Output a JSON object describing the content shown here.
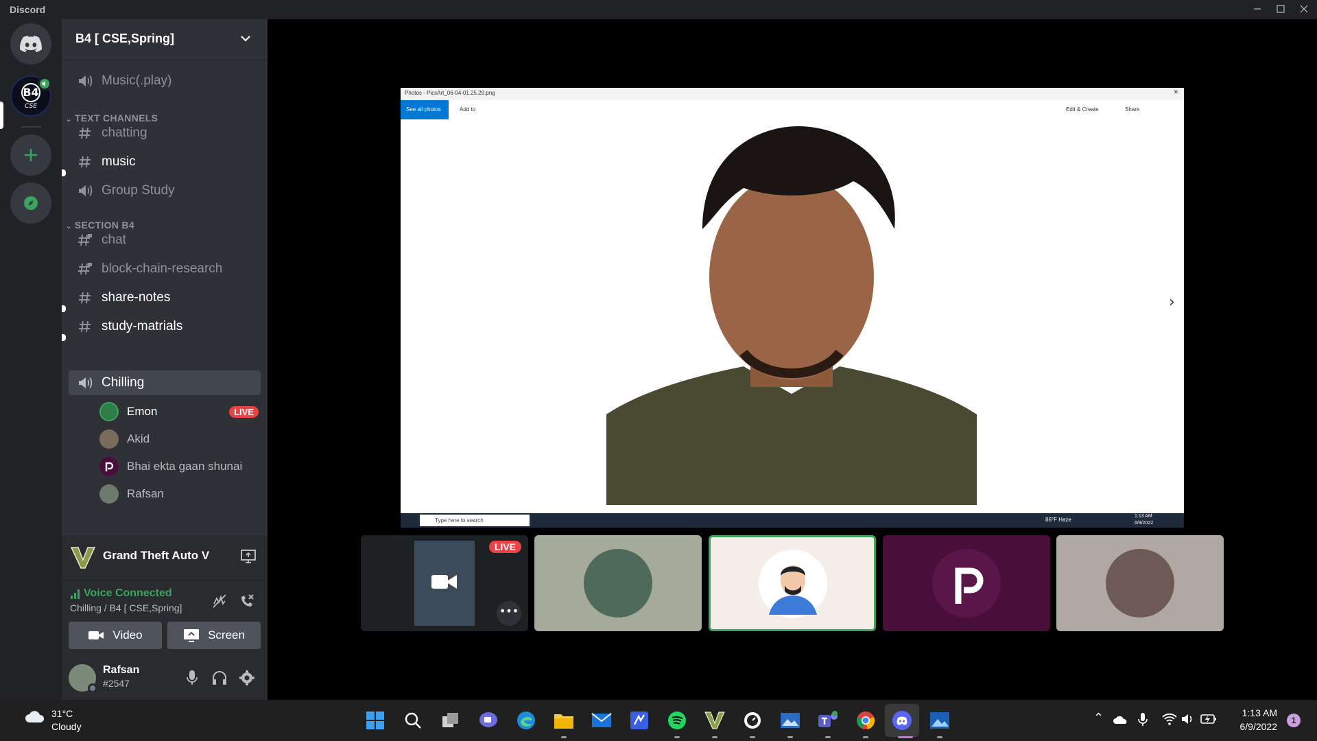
{
  "window": {
    "title": "Discord",
    "minimize_icon": "minimize-icon",
    "maximize_icon": "maximize-icon",
    "close_icon": "close-icon"
  },
  "guilds": [
    {
      "name": "Home",
      "icon": "discord-logo-icon"
    },
    {
      "name": "B4 CSE",
      "icon": "server-b4-icon",
      "avatar_text": "B4",
      "avatar_sub": "CSE"
    },
    {
      "name": "Add a Server",
      "icon": "plus-icon"
    },
    {
      "name": "Explore Public Servers",
      "icon": "compass-icon"
    }
  ],
  "server": {
    "name": "B4 [ CSE,Spring]"
  },
  "channels_top": [
    {
      "name": "Music(.play)",
      "type": "voice"
    }
  ],
  "categories": [
    {
      "name": "TEXT CHANNELS",
      "channels": [
        {
          "name": "chatting",
          "type": "text",
          "unread": false
        },
        {
          "name": "music",
          "type": "text",
          "unread": true
        },
        {
          "name": "Group Study",
          "type": "voice",
          "unread": false
        }
      ]
    },
    {
      "name": "SECTION B4",
      "channels": [
        {
          "name": "chat",
          "type": "text-locked",
          "unread": false
        },
        {
          "name": "block-chain-research",
          "type": "text-locked",
          "unread": false
        },
        {
          "name": "share-notes",
          "type": "text",
          "unread": true
        },
        {
          "name": "study-matrials",
          "type": "text",
          "unread": true
        },
        {
          "name": "Chilling",
          "type": "voice",
          "unread": false,
          "active": true
        }
      ]
    }
  ],
  "voice_users": [
    {
      "name": "Emon",
      "badge": "LIVE"
    },
    {
      "name": "Akid"
    },
    {
      "name": "Bhai ekta gaan shunai"
    },
    {
      "name": "Rafsan"
    }
  ],
  "activity": {
    "game": "Grand Theft Auto V",
    "stream_icon": "screen-share-icon"
  },
  "voice_status": {
    "state": "Voice Connected",
    "location": "Chilling / B4 [ CSE,Spring]"
  },
  "voice_buttons": {
    "video": "Video",
    "screen": "Screen"
  },
  "user": {
    "name": "Rafsan",
    "tag": "#2547"
  },
  "stream": {
    "photos_title": "Photos - PicsArt_06-04-01.25.29.png",
    "see_all": "See all photos",
    "add_to": "Add to",
    "edit_create": "Edit & Create",
    "share": "Share",
    "search_placeholder": "Type here to search",
    "weather": "86°F Haze",
    "time": "1:13 AM",
    "date": "6/9/2022"
  },
  "tiles": [
    {
      "label": "LIVE",
      "type": "stream"
    },
    {
      "type": "avatar"
    },
    {
      "type": "avatar",
      "speaking": true
    },
    {
      "type": "avatar"
    },
    {
      "type": "avatar"
    }
  ],
  "taskbar": {
    "weather_temp": "31°C",
    "weather_desc": "Cloudy",
    "time": "1:13 AM",
    "date": "6/9/2022",
    "notifications": "1",
    "apps": [
      "start-icon",
      "search-icon",
      "task-view-icon",
      "chat-icon",
      "edge-icon",
      "file-explorer-icon",
      "mail-icon",
      "visual-studio-icon",
      "spotify-icon",
      "gta-icon",
      "clock-app-icon",
      "photos-app-icon",
      "teams-icon",
      "chrome-icon",
      "discord-icon",
      "photos-icon"
    ]
  },
  "colors": {
    "accent": "#5865f2",
    "green": "#3ba55d",
    "live": "#ed4245",
    "sidebar": "#2f3136",
    "guilds": "#202225"
  }
}
